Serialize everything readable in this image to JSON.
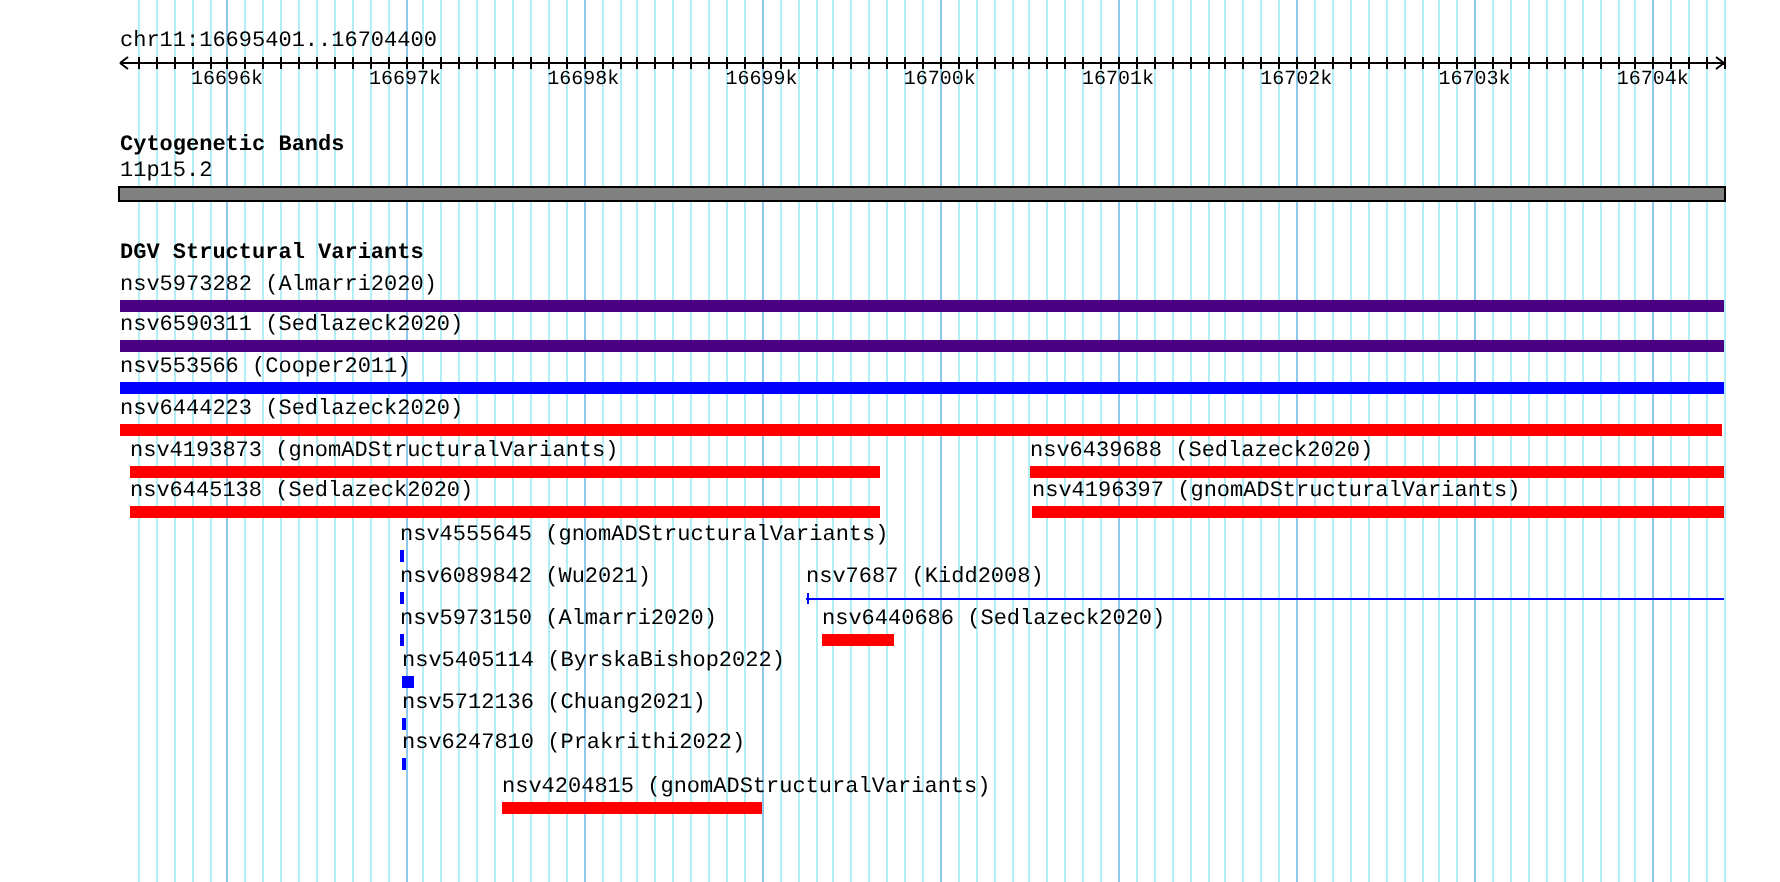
{
  "ruler": {
    "region": "chr11:16695401..16704400",
    "ticks": [
      "16696k",
      "16697k",
      "16698k",
      "16699k",
      "16700k",
      "16701k",
      "16702k",
      "16703k",
      "16704k"
    ]
  },
  "tracks": [
    {
      "title": "Cytogenetic Bands",
      "kind": "bands",
      "items": [
        {
          "label": "11p15.2"
        }
      ]
    },
    {
      "title": "DGV Structural Variants",
      "kind": "variants",
      "items": [
        {
          "label": "nsv5973282 (Almarri2020)",
          "kind": "bar",
          "color": "#4b0082"
        },
        {
          "label": "nsv6590311 (Sedlazeck2020)",
          "kind": "bar",
          "color": "#4b0082"
        },
        {
          "label": "nsv553566 (Cooper2011)",
          "kind": "bar",
          "color": "#0000ff"
        },
        {
          "label": "nsv6444223 (Sedlazeck2020)",
          "kind": "bar",
          "color": "#ff0000"
        },
        {
          "label": "nsv4193873 (gnomADStructuralVariants)",
          "kind": "bar",
          "color": "#ff0000"
        },
        {
          "label": "nsv6439688 (Sedlazeck2020)",
          "kind": "bar",
          "color": "#ff0000"
        },
        {
          "label": "nsv6445138 (Sedlazeck2020)",
          "kind": "bar",
          "color": "#ff0000"
        },
        {
          "label": "nsv4196397 (gnomADStructuralVariants)",
          "kind": "bar",
          "color": "#ff0000"
        },
        {
          "label": "nsv4555645 (gnomADStructuralVariants)",
          "kind": "bar",
          "color": "#0000ff"
        },
        {
          "label": "nsv6089842 (Wu2021)",
          "kind": "bar",
          "color": "#0000ff"
        },
        {
          "label": "nsv7687 (Kidd2008)",
          "kind": "line",
          "color": "#0000ff"
        },
        {
          "label": "nsv5973150 (Almarri2020)",
          "kind": "bar",
          "color": "#0000ff"
        },
        {
          "label": "nsv6440686 (Sedlazeck2020)",
          "kind": "bar",
          "color": "#ff0000"
        },
        {
          "label": "nsv5405114 (ByrskaBishop2022)",
          "kind": "bar",
          "color": "#0000ff"
        },
        {
          "label": "nsv5712136 (Chuang2021)",
          "kind": "bar",
          "color": "#0000ff"
        },
        {
          "label": "nsv6247810 (Prakrithi2022)",
          "kind": "bar",
          "color": "#0000ff"
        },
        {
          "label": "nsv4204815 (gnomADStructuralVariants)",
          "kind": "bar",
          "color": "#ff0000"
        }
      ]
    }
  ]
}
